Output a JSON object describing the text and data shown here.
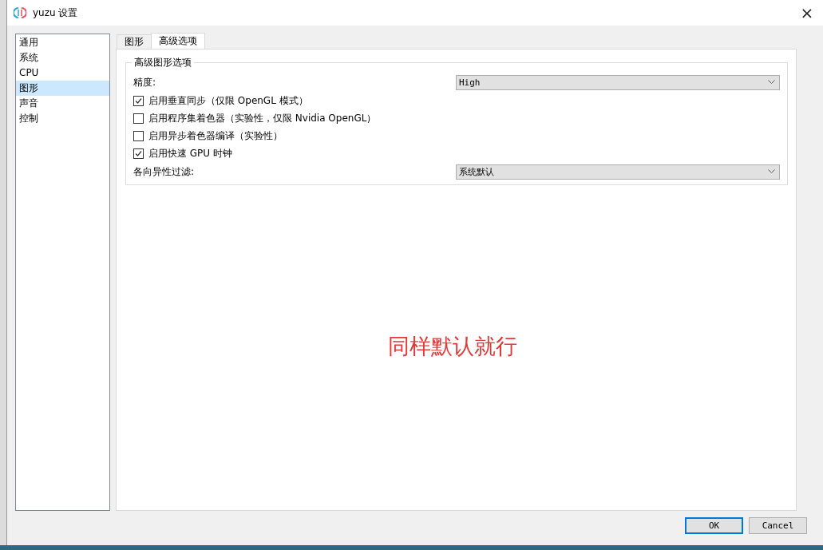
{
  "window": {
    "title": "yuzu 设置",
    "close": "×"
  },
  "sidebar": {
    "items": [
      {
        "label": "通用",
        "selected": false
      },
      {
        "label": "系统",
        "selected": false
      },
      {
        "label": "CPU",
        "selected": false
      },
      {
        "label": "图形",
        "selected": true
      },
      {
        "label": "声音",
        "selected": false
      },
      {
        "label": "控制",
        "selected": false
      }
    ]
  },
  "tabs": [
    {
      "label": "图形",
      "selected": false
    },
    {
      "label": "高级选项",
      "selected": true
    }
  ],
  "group": {
    "title": "高级图形选项",
    "rows": [
      {
        "kind": "combo",
        "label": "精度:",
        "value": "High"
      },
      {
        "kind": "checkbox",
        "label": "启用垂直同步（仅限 OpenGL 模式）",
        "checked": true
      },
      {
        "kind": "checkbox",
        "label": "启用程序集着色器（实验性，仅限 Nvidia OpenGL）",
        "checked": false
      },
      {
        "kind": "checkbox",
        "label": "启用异步着色器编译（实验性）",
        "checked": false
      },
      {
        "kind": "checkbox",
        "label": "启用快速 GPU 时钟",
        "checked": true
      },
      {
        "kind": "combo",
        "label": "各向异性过滤:",
        "value": "系统默认"
      }
    ]
  },
  "annotation": "同样默认就行",
  "buttons": [
    {
      "label": "OK",
      "default": true
    },
    {
      "label": "Cancel",
      "default": false
    }
  ]
}
